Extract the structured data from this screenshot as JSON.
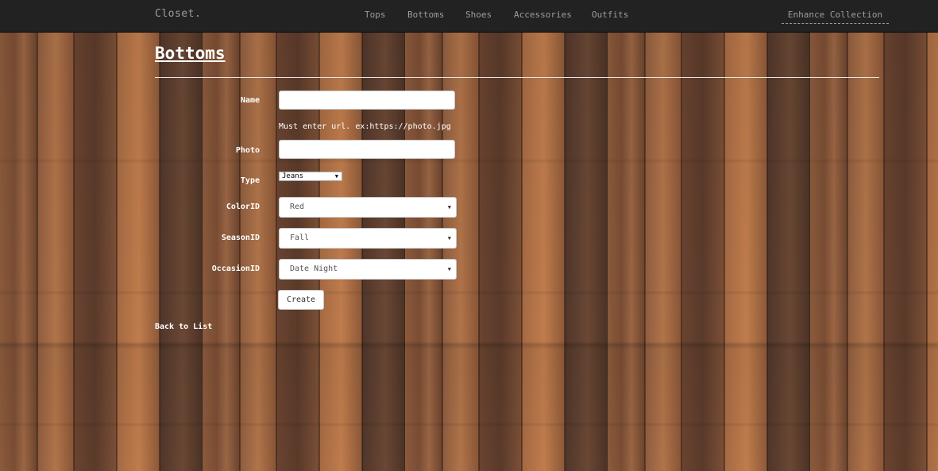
{
  "navbar": {
    "brand": "Closet.",
    "links": [
      "Tops",
      "Bottoms",
      "Shoes",
      "Accessories",
      "Outfits"
    ],
    "enhance": "Enhance Collection"
  },
  "page": {
    "title": "Bottoms"
  },
  "form": {
    "name_label": "Name",
    "name_value": "",
    "photo_hint": "Must enter url. ex:https://photo.jpg",
    "photo_label": "Photo",
    "photo_value": "",
    "type_label": "Type",
    "type_value": "Jeans",
    "color_label": "ColorID",
    "color_value": "Red",
    "season_label": "SeasonID",
    "season_value": "Fall",
    "occasion_label": "OccasionID",
    "occasion_value": "Date Night",
    "create_button": "Create"
  },
  "back_link": "Back to List",
  "icons": {
    "select_arrow": "dropdown-arrow-icon"
  }
}
